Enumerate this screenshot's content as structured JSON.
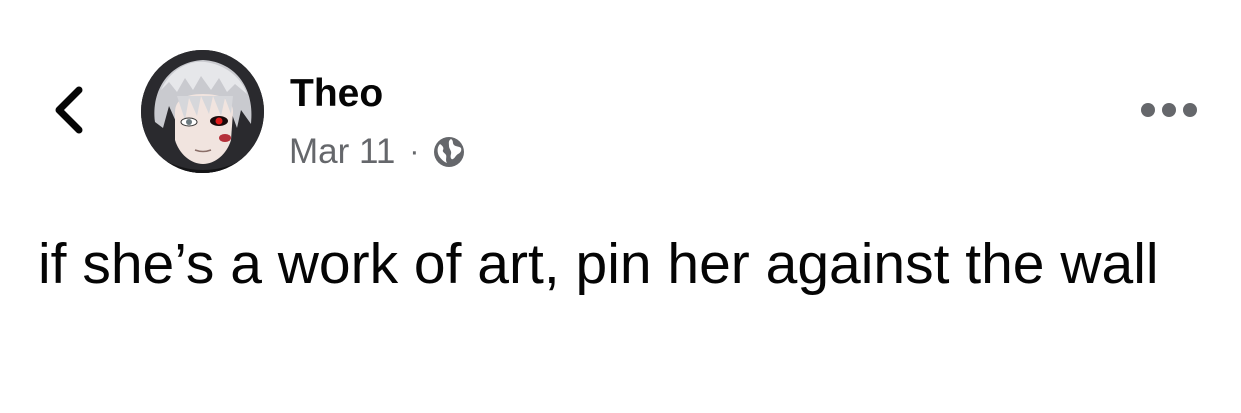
{
  "post": {
    "author": {
      "name": "Theo",
      "avatar": "profile-picture"
    },
    "date": "Mar 11",
    "separator": "·",
    "audience_icon": "globe-icon",
    "text": "if she’s a work of art, pin her against the wall"
  },
  "navigation": {
    "back_icon": "chevron-left-icon",
    "more_icon": "more-horizontal-icon"
  },
  "colors": {
    "text_primary": "#050505",
    "text_secondary": "#65676b",
    "background": "#ffffff"
  }
}
